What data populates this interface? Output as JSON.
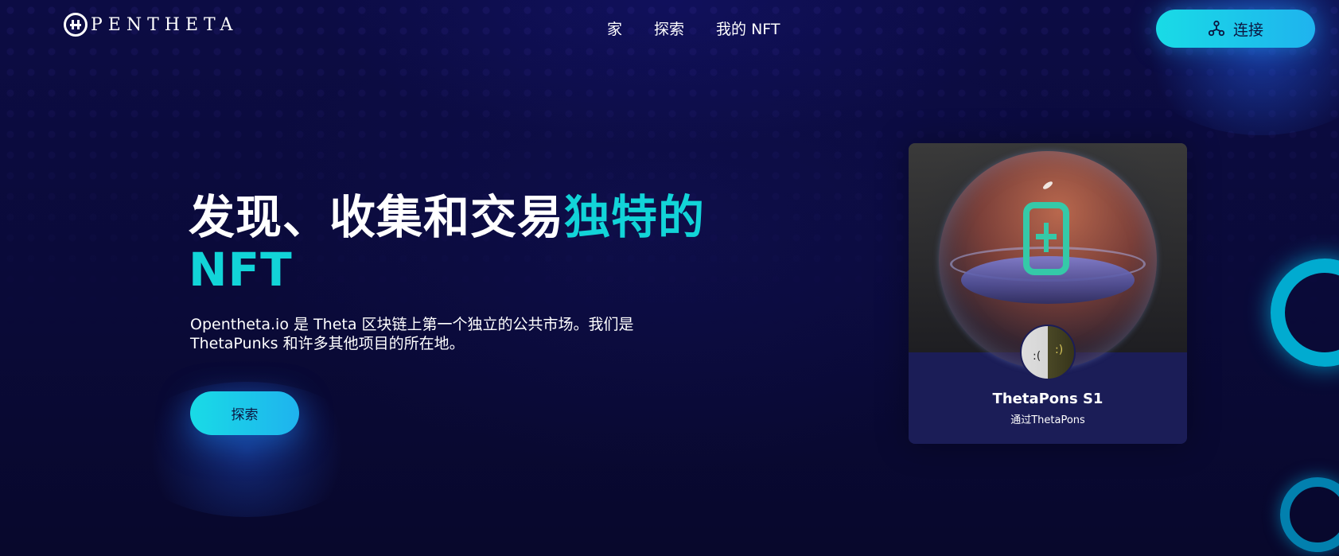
{
  "header": {
    "logo_text": "PENTHETA",
    "nav": [
      "家",
      "探索",
      "我的 NFT"
    ],
    "connect_label": "连接"
  },
  "hero": {
    "title_main": "发现、收集和交易",
    "title_accent_1": "独特的",
    "title_accent_2": "NFT",
    "description": "Opentheta.io 是 Theta 区块链上第一个独立的公共市场。我们是 ThetaPunks 和许多其他项目的所在地。",
    "explore_label": "探索"
  },
  "card": {
    "title": "ThetaPons S1",
    "subtitle": "通过ThetaPons"
  },
  "colors": {
    "background": "#0b0b3a",
    "accent": "#12d4d8",
    "button_gradient_start": "#19dbe6",
    "button_gradient_end": "#1fb3ee",
    "card_background": "#1b1d57"
  },
  "icons": {
    "logo": "opentheta-logo-icon",
    "connect": "network-nodes-icon"
  }
}
